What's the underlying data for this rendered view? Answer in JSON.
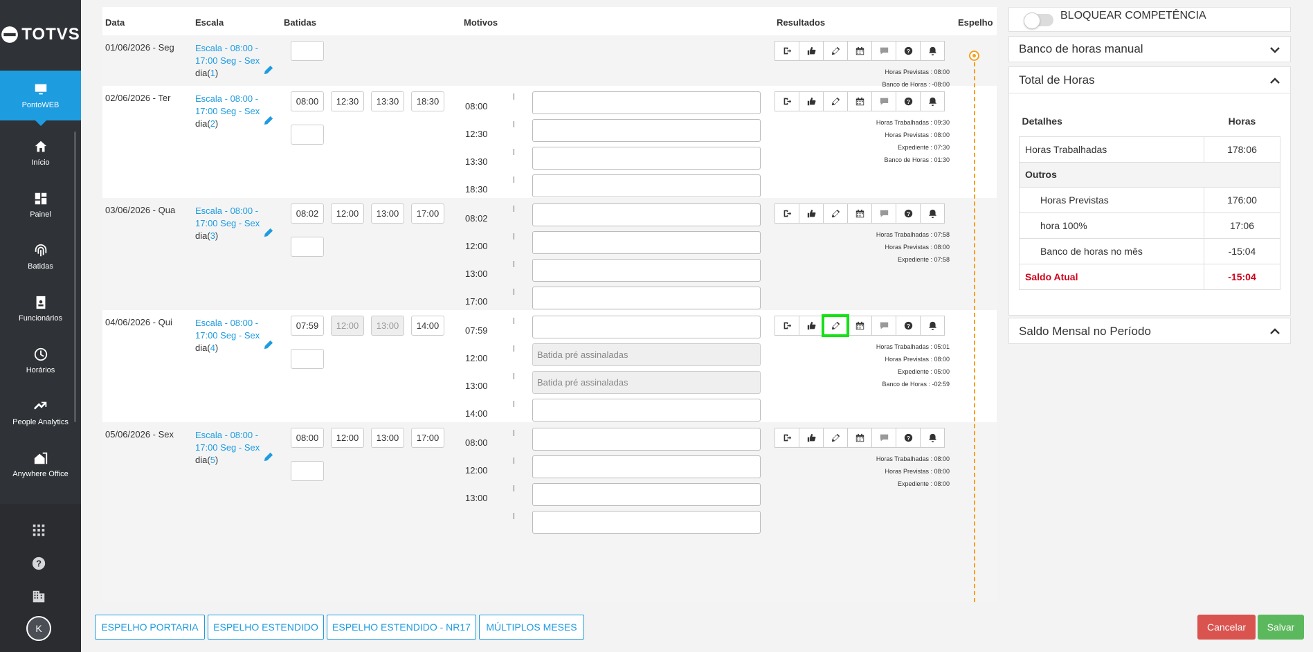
{
  "sidebar": {
    "brand": "TOTVS",
    "items": [
      {
        "label": "PontoWEB",
        "icon": "monitor-icon"
      },
      {
        "label": "Início",
        "icon": "home-icon"
      },
      {
        "label": "Painel",
        "icon": "dashboard-icon"
      },
      {
        "label": "Batidas",
        "icon": "fingerprint-icon"
      },
      {
        "label": "Funcionários",
        "icon": "badge-icon"
      },
      {
        "label": "Horários",
        "icon": "clock-icon"
      },
      {
        "label": "People Analytics",
        "icon": "trending-up-icon"
      },
      {
        "label": "Anywhere Office",
        "icon": "house-work-icon"
      }
    ],
    "avatar_initial": "K"
  },
  "table": {
    "headers": {
      "data": "Data",
      "escala": "Escala",
      "batidas": "Batidas",
      "motivos": "Motivos",
      "resultados": "Resultados",
      "espelho": "Espelho"
    },
    "days": [
      {
        "date": "01/06/2026 - Seg",
        "escala_line1": "Escala - 08:00 -",
        "escala_line2": "17:00 Seg - Sex",
        "dia_label": "dia(",
        "dia_num": "1",
        "dia_close": ")",
        "batidas": [],
        "motivos": [],
        "results": [
          "Horas Previstas : 08:00",
          "Banco de Horas : -08:00"
        ]
      },
      {
        "date": "02/06/2026 - Ter",
        "escala_line1": "Escala - 08:00 -",
        "escala_line2": "17:00 Seg - Sex",
        "dia_label": "dia(",
        "dia_num": "2",
        "dia_close": ")",
        "batidas": [
          {
            "v": "08:00"
          },
          {
            "v": "12:30"
          },
          {
            "v": "13:30"
          },
          {
            "v": "18:30"
          }
        ],
        "motivos": [
          {
            "time": "08:00",
            "text": ""
          },
          {
            "time": "12:30",
            "text": ""
          },
          {
            "time": "13:30",
            "text": ""
          },
          {
            "time": "18:30",
            "text": ""
          }
        ],
        "results": [
          "Horas Trabalhadas : 09:30",
          "Horas Previstas : 08:00",
          "Expediente : 07:30",
          "Banco de Horas : 01:30"
        ]
      },
      {
        "date": "03/06/2026 - Qua",
        "escala_line1": "Escala - 08:00 -",
        "escala_line2": "17:00 Seg - Sex",
        "dia_label": "dia(",
        "dia_num": "3",
        "dia_close": ")",
        "batidas": [
          {
            "v": "08:02"
          },
          {
            "v": "12:00"
          },
          {
            "v": "13:00"
          },
          {
            "v": "17:00"
          }
        ],
        "motivos": [
          {
            "time": "08:02",
            "text": ""
          },
          {
            "time": "12:00",
            "text": ""
          },
          {
            "time": "13:00",
            "text": ""
          },
          {
            "time": "17:00",
            "text": ""
          }
        ],
        "results": [
          "Horas Trabalhadas : 07:58",
          "Horas Previstas : 08:00",
          "Expediente : 07:58"
        ]
      },
      {
        "date": "04/06/2026 - Qui",
        "escala_line1": "Escala - 08:00 -",
        "escala_line2": "17:00 Seg - Sex",
        "dia_label": "dia(",
        "dia_num": "4",
        "dia_close": ")",
        "batidas": [
          {
            "v": "07:59"
          },
          {
            "v": "12:00",
            "dis": true
          },
          {
            "v": "13:00",
            "dis": true
          },
          {
            "v": "14:00"
          }
        ],
        "motivos": [
          {
            "time": "07:59",
            "text": ""
          },
          {
            "time": "12:00",
            "text": "Batida pré assinaladas",
            "dis": true
          },
          {
            "time": "13:00",
            "text": "Batida pré assinaladas",
            "dis": true
          },
          {
            "time": "14:00",
            "text": ""
          }
        ],
        "results": [
          "Horas Trabalhadas : 05:01",
          "Horas Previstas : 08:00",
          "Expediente : 05:00",
          "Banco de Horas : -02:59"
        ]
      },
      {
        "date": "05/06/2026 - Sex",
        "escala_line1": "Escala - 08:00 -",
        "escala_line2": "17:00 Seg - Sex",
        "dia_label": "dia(",
        "dia_num": "5",
        "dia_close": ")",
        "batidas": [
          {
            "v": "08:00"
          },
          {
            "v": "12:00"
          },
          {
            "v": "13:00"
          },
          {
            "v": "17:00"
          }
        ],
        "motivos": [
          {
            "time": "08:00",
            "text": ""
          },
          {
            "time": "12:00",
            "text": ""
          },
          {
            "time": "13:00",
            "text": ""
          },
          {
            "time": "",
            "text": ""
          }
        ],
        "results": [
          "Horas Trabalhadas : 08:00",
          "Horas Previstas : 08:00",
          "Expediente : 08:00"
        ]
      }
    ],
    "tool_icons": [
      "exit-icon",
      "thumbs-up-icon",
      "pencil-icon",
      "calendar-icon",
      "comment-icon",
      "help-icon",
      "bell-icon"
    ]
  },
  "footer": {
    "espelho_portaria": "ESPELHO PORTARIA",
    "espelho_estendido": "ESPELHO ESTENDIDO",
    "espelho_nr17": "ESPELHO ESTENDIDO - NR17",
    "multiplos_meses": "MÚLTIPLOS MESES",
    "cancelar": "Cancelar",
    "salvar": "Salvar"
  },
  "right": {
    "bloquear": "BLOQUEAR COMPETÊNCIA",
    "banco_manual": "Banco de horas manual",
    "total_horas": "Total de Horas",
    "saldo_mensal": "Saldo Mensal no Período",
    "totals_table": {
      "col_detalhes": "Detalhes",
      "col_horas": "Horas",
      "rows": [
        {
          "label": "Horas Trabalhadas",
          "value": "178:06"
        },
        {
          "label": "Outros",
          "value": ""
        },
        {
          "label": "Horas Previstas",
          "value": "176:00"
        },
        {
          "label": "hora 100%",
          "value": "17:06"
        },
        {
          "label": "Banco de horas no mês",
          "value": "-15:04"
        },
        {
          "label": "Saldo Atual",
          "value": "-15:04"
        }
      ]
    }
  },
  "colors": {
    "accent": "#1e9ce0",
    "sidebar": "#2f3237",
    "cancel": "#d9534f",
    "save": "#5cb85c",
    "highlight": "#16e016",
    "timeline": "#f5a11e",
    "negative": "#d0021b"
  }
}
